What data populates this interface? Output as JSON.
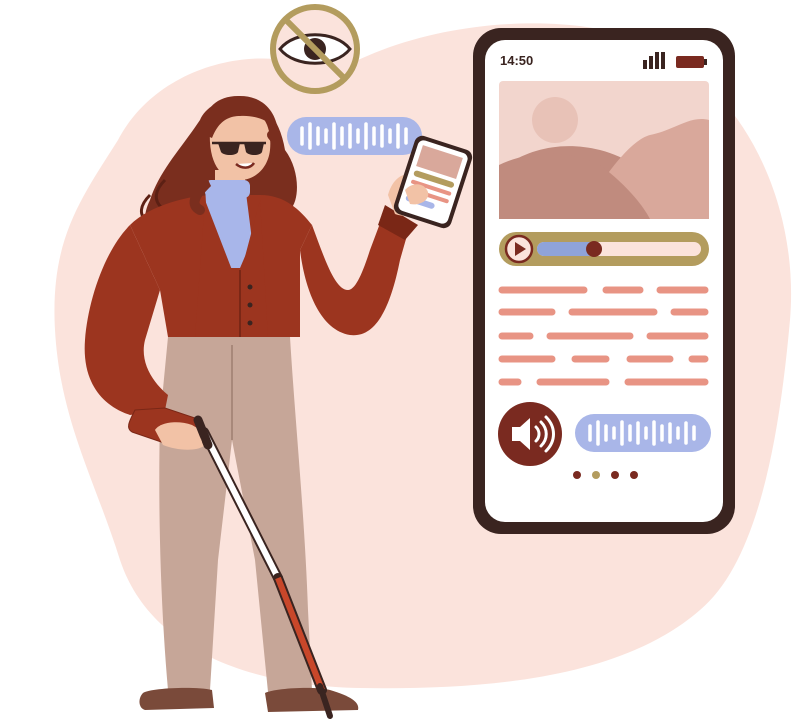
{
  "phone": {
    "status_time": "14:50",
    "progress_fraction": 0.36,
    "carousel_active_index": 1,
    "carousel_count": 4
  },
  "icons": {
    "crossed_eye": "eye-crossed-icon",
    "play": "play-icon",
    "speaker": "speaker-icon",
    "signal": "signal-icon",
    "battery": "battery-icon"
  },
  "colors": {
    "blob": "#fbe3dc",
    "phone_frame": "#3a2420",
    "image_bg": "#f2d5cd",
    "mountain_dark": "#c08b7e",
    "mountain_light": "#d9a89b",
    "sun": "#e8c2b7",
    "bar_frame": "#b39c5e",
    "bar_track": "#fbe3dc",
    "bar_fill": "#8fa3d9",
    "knob": "#7a2a20",
    "text_line": "#e89484",
    "speaker_bg": "#7a2a20",
    "voice_bubble": "#a9b6e8",
    "voice_bars": "#ffffff",
    "dot_active": "#b39c5e",
    "dot": "#7a2a20",
    "jacket": "#9c351f",
    "jacket_dark": "#7a2716",
    "pants": "#c6a698",
    "hair": "#7a2e1e",
    "skin": "#f2c2a6",
    "shirt": "#a8b6ea",
    "cane_white": "#ffffff",
    "cane_red": "#c8472a",
    "shoes": "#7a4a3a"
  }
}
